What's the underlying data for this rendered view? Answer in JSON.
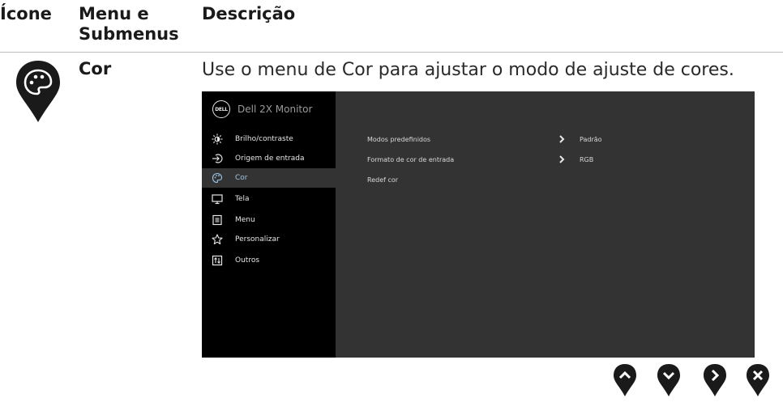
{
  "header": {
    "icon_col": "Ícone",
    "menu_col": "Menu e Submenus",
    "desc_col": "Descrição"
  },
  "section": {
    "menu_name": "Cor",
    "description": "Use o menu de Cor para ajustar o modo de ajuste de cores.",
    "icon": "palette-pin-icon"
  },
  "osd": {
    "logo": "DELL",
    "title": "Dell 2X Monitor",
    "nav": [
      {
        "label": "Brilho/contraste",
        "icon": "brightness-icon"
      },
      {
        "label": "Origem de entrada",
        "icon": "input-source-icon"
      },
      {
        "label": "Cor",
        "icon": "palette-icon",
        "active": true
      },
      {
        "label": "Tela",
        "icon": "display-icon"
      },
      {
        "label": "Menu",
        "icon": "menu-icon"
      },
      {
        "label": "Personalizar",
        "icon": "star-icon"
      },
      {
        "label": "Outros",
        "icon": "others-icon"
      }
    ],
    "settings": [
      {
        "label": "Modos predefinidos",
        "value": "Padrão"
      },
      {
        "label": "Formato de cor de entrada",
        "value": "RGB"
      },
      {
        "label": "Redef cor",
        "value": ""
      }
    ]
  },
  "buttons": [
    "up-button",
    "down-button",
    "right-button",
    "close-button"
  ],
  "colors": {
    "osd_bg": "#333333",
    "osd_sidebar": "#000000",
    "active_text": "#9ec6e8",
    "pin": "#1a1a1a"
  }
}
